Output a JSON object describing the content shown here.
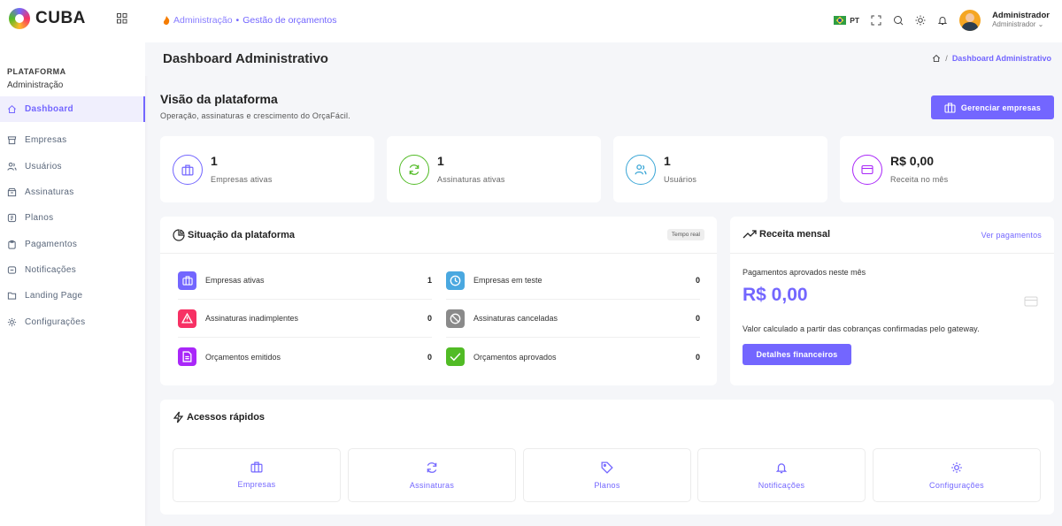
{
  "sidebar": {
    "brand": "CUBA",
    "section_title": "PLATAFORMA",
    "section_sub": "Administração",
    "items": [
      {
        "label": "Dashboard"
      },
      {
        "label": "Empresas"
      },
      {
        "label": "Usuários"
      },
      {
        "label": "Assinaturas"
      },
      {
        "label": "Planos"
      },
      {
        "label": "Pagamentos"
      },
      {
        "label": "Notificações"
      },
      {
        "label": "Landing Page"
      },
      {
        "label": "Configurações"
      }
    ]
  },
  "header": {
    "crumb_root": "Administração",
    "crumb_sep": "•",
    "crumb_page": "Gestão de orçamentos",
    "lang": "PT",
    "user_name": "Administrador",
    "user_role": "Administrador"
  },
  "titlebar": {
    "title": "Dashboard Administrativo",
    "crumb_sep": "/",
    "crumb": "Dashboard Administrativo"
  },
  "overview": {
    "title": "Visão da plataforma",
    "subtitle": "Operação, assinaturas e crescimento do OrçaFácil.",
    "manage_label": "Gerenciar empresas"
  },
  "stats": [
    {
      "value": "1",
      "label": "Empresas ativas",
      "color": "#7366ff"
    },
    {
      "value": "1",
      "label": "Assinaturas ativas",
      "color": "#51bb25"
    },
    {
      "value": "1",
      "label": "Usuários",
      "color": "#3aa6d6"
    },
    {
      "value": "R$ 0,00",
      "label": "Receita no mês",
      "color": "#a927f9"
    }
  ],
  "situacao": {
    "title": "Situação da plataforma",
    "badge": "Tempo real",
    "rows": [
      {
        "label": "Empresas ativas",
        "value": "1",
        "color": "#7366ff"
      },
      {
        "label": "Empresas em teste",
        "value": "0",
        "color": "#4aa8e0"
      },
      {
        "label": "Assinaturas inadimplentes",
        "value": "0",
        "color": "#f73164"
      },
      {
        "label": "Assinaturas canceladas",
        "value": "0",
        "color": "#8a8a8a"
      },
      {
        "label": "Orçamentos emitidos",
        "value": "0",
        "color": "#a927f9"
      },
      {
        "label": "Orçamentos aprovados",
        "value": "0",
        "color": "#51bb25"
      }
    ]
  },
  "receita": {
    "title": "Receita mensal",
    "link": "Ver pagamentos",
    "subtitle": "Pagamentos aprovados neste mês",
    "value": "R$ 0,00",
    "note": "Valor calculado a partir das cobranças confirmadas pelo gateway.",
    "button": "Detalhes financeiros"
  },
  "acessos": {
    "title": "Acessos rápidos",
    "tiles": [
      {
        "label": "Empresas"
      },
      {
        "label": "Assinaturas"
      },
      {
        "label": "Planos"
      },
      {
        "label": "Notificações"
      },
      {
        "label": "Configurações"
      }
    ]
  },
  "colors": {
    "accent": "#7366ff"
  }
}
